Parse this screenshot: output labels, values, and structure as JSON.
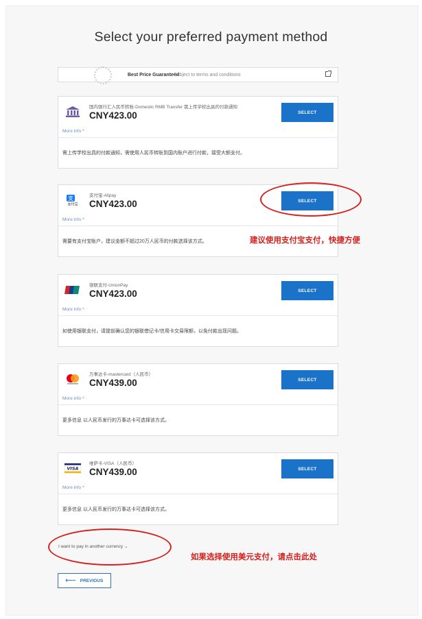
{
  "page": {
    "title": "Select your preferred payment method"
  },
  "promo": {
    "title": "Best Price Guaranteed",
    "subtitle": "Subject to terms and conditions",
    "icon": "external-link-icon"
  },
  "methods": [
    {
      "name": "国内银行汇人民币转账-Domestic RMB Transfer 需上传学校出具的付款通知",
      "price": "CNY423.00",
      "select_label": "SELECT",
      "more_info": "More info ^",
      "description": "需上传学校出具的付款通知，需使用人民币转账到国内账户进行付款，接受大额支付。",
      "icon": "bank-icon"
    },
    {
      "name": "支付宝-Alipay",
      "price": "CNY423.00",
      "select_label": "SELECT",
      "more_info": "More info ^",
      "description": "需要有支付宝账户，建议金额不超过20万人民币的付款选择该方式。",
      "icon": "alipay-icon"
    },
    {
      "name": "银联支付-UnionPay",
      "price": "CNY423.00",
      "select_label": "SELECT",
      "more_info": "More info ^",
      "description": "如使用银联支付，请提前确认您的银联借记卡/信用卡交易限额，以免付款出现问题。",
      "icon": "unionpay-icon"
    },
    {
      "name": "万事达卡-mastercard（人民币）",
      "price": "CNY439.00",
      "select_label": "SELECT",
      "more_info": "More info ^",
      "description": "更多信息 以人民币发行的万事达卡可选择该方式。",
      "icon": "mastercard-icon"
    },
    {
      "name": "维萨卡-VISA（人民币）",
      "price": "CNY439.00",
      "select_label": "SELECT",
      "more_info": "More info ^",
      "description": "更多信息 以人民币发行的万事达卡可选择该方式。",
      "icon": "visa-icon"
    }
  ],
  "annotations": {
    "alipay_note": "建议使用支付宝支付，快捷方便",
    "usd_note": "如果选择使用美元支付，请点击此处",
    "color": "#d6201c"
  },
  "footer": {
    "other_currency": "I want to pay in another currency ⌄",
    "previous_label": "PREVIOUS",
    "previous_icon": "arrow-left-icon"
  },
  "colors": {
    "select_button": "#1a73c8",
    "more_info_link": "#6a8fbf"
  }
}
